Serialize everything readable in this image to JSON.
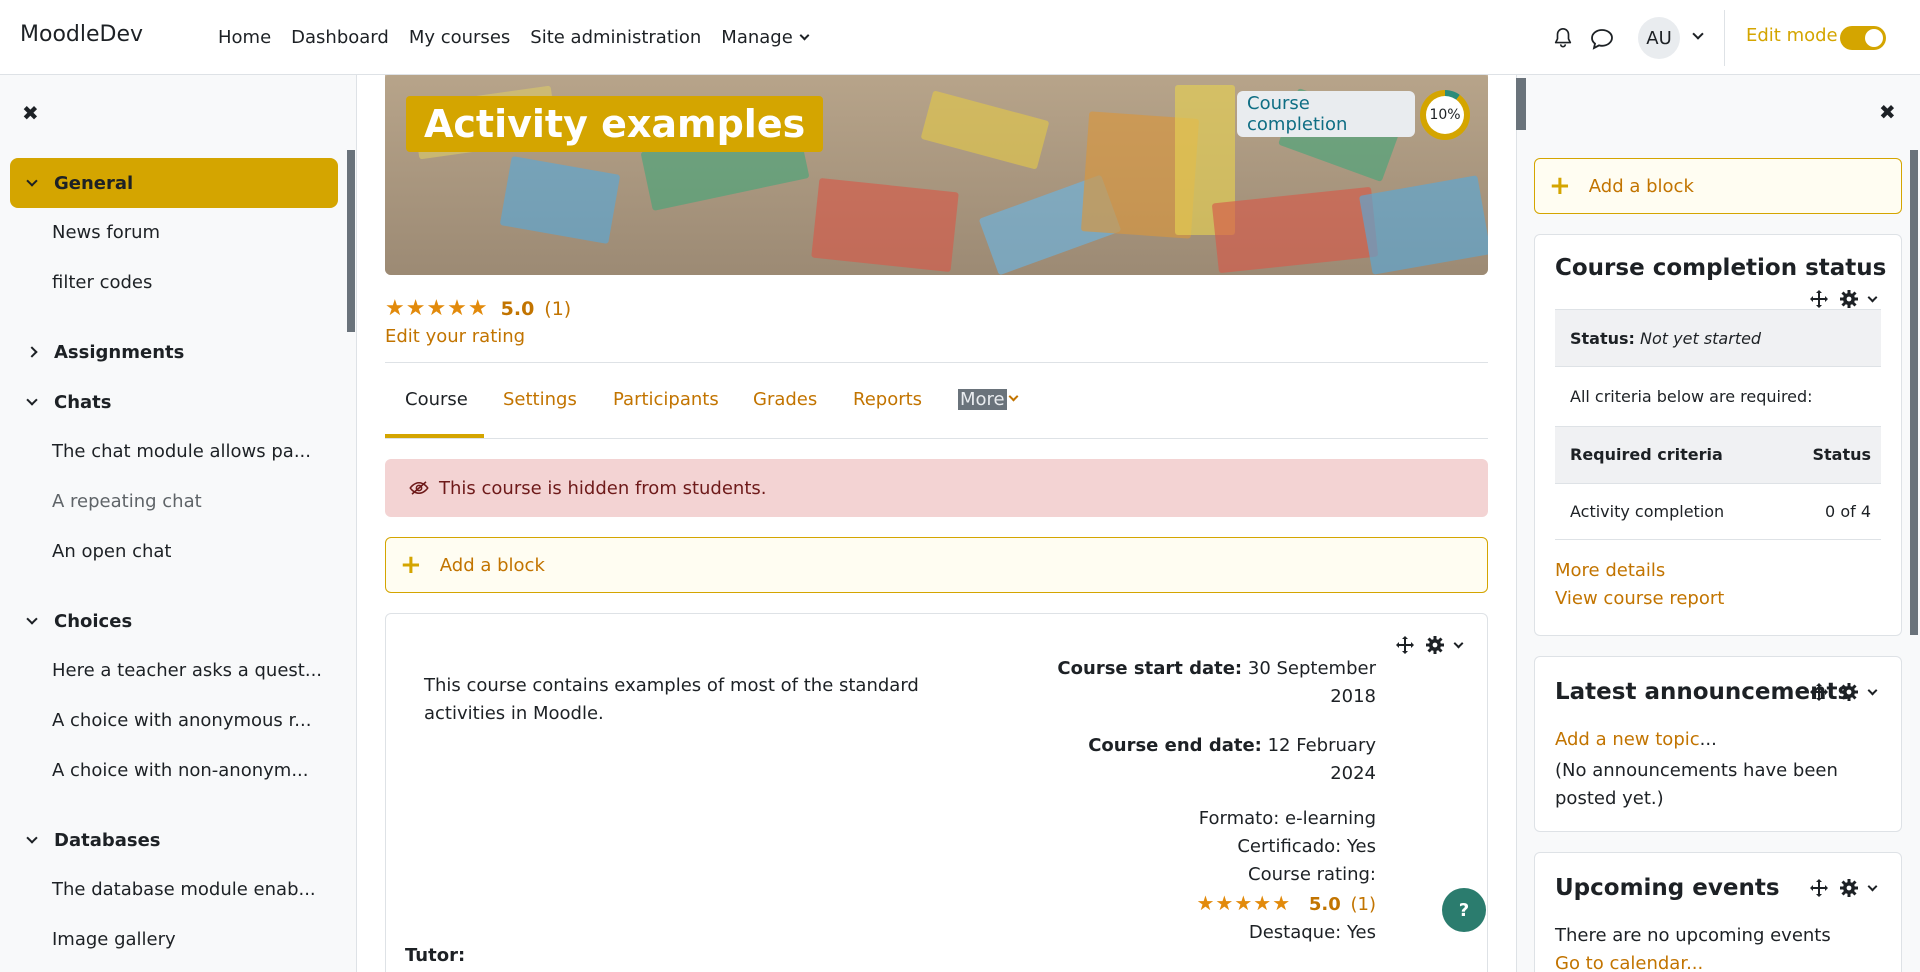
{
  "navbar": {
    "brand": "MoodleDev",
    "links": [
      "Home",
      "Dashboard",
      "My courses",
      "Site administration",
      "Manage"
    ],
    "avatar_initials": "AU",
    "edit_mode_label": "Edit mode",
    "edit_mode_on": true
  },
  "left_drawer": {
    "close_icon": "close-icon",
    "sections": [
      {
        "label": "General",
        "expanded": true,
        "active": true,
        "items": [
          "News forum",
          "filter codes"
        ]
      },
      {
        "label": "Assignments",
        "expanded": false,
        "items": []
      },
      {
        "label": "Chats",
        "expanded": true,
        "items": [
          "The chat module allows pa...",
          "A repeating chat",
          "An open chat"
        ]
      },
      {
        "label": "Choices",
        "expanded": true,
        "items": [
          "Here a teacher asks a quest...",
          "A choice with anonymous r...",
          "A choice with non-anonym..."
        ]
      },
      {
        "label": "Databases",
        "expanded": true,
        "items": [
          "The database module enab...",
          "Image gallery"
        ]
      }
    ]
  },
  "hero": {
    "title": "Activity examples",
    "completion_label": "Course completion",
    "completion_percent": "10%",
    "completion_fraction": 0.1
  },
  "rating": {
    "stars": "★★★★★",
    "value": "5.0",
    "count": "(1)",
    "edit_label": "Edit your rating"
  },
  "tabs": [
    "Course",
    "Settings",
    "Participants",
    "Grades",
    "Reports",
    "More"
  ],
  "alert": {
    "text": "This course is hidden from students."
  },
  "add_block_label": "Add a block",
  "summary": {
    "description": "This course contains examples of most of the standard activities in Moodle.",
    "start_label": "Course start date:",
    "start_value_1": "30 September",
    "start_value_2": "2018",
    "end_label": "Course end date:",
    "end_value_1": "12 February",
    "end_value_2": "2024",
    "formato": "Formato: e-learning",
    "certificado": "Certificado: Yes",
    "course_rating_label": "Course rating:",
    "destaque": "Destaque: Yes",
    "tutor_label": "Tutor:",
    "help": "?"
  },
  "right_drawer": {
    "add_block_label": "Add a block",
    "completion_block": {
      "title": "Course completion status",
      "status_label": "Status:",
      "status_value": "Not yet started",
      "required_note": "All criteria below are required:",
      "col_criteria": "Required criteria",
      "col_status": "Status",
      "row_criteria": "Activity completion",
      "row_status": "0 of 4",
      "more_details": "More details",
      "view_report": "View course report"
    },
    "announcements_block": {
      "title": "Latest announcements",
      "add_topic": "Add a new topic",
      "ellipsis": "...",
      "empty": "(No announcements have been posted yet.)"
    },
    "events_block": {
      "title": "Upcoming events",
      "empty": "There are no upcoming events",
      "calendar_link": "Go to calendar..."
    }
  },
  "colors": {
    "accent": "#d4a500",
    "link": "#c27400",
    "alert_bg": "#f3d3d3",
    "help_bg": "#2b7c6e"
  }
}
